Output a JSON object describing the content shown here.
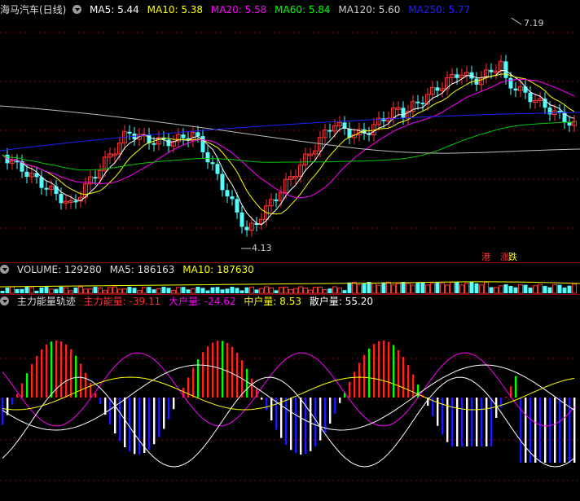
{
  "header": {
    "title": "海马汽车(日线)",
    "ma": [
      {
        "label": "MA5: 5.44",
        "color": "#ffffff"
      },
      {
        "label": "MA10: 5.38",
        "color": "#ffff00"
      },
      {
        "label": "MA20: 5.58",
        "color": "#ff00ff"
      },
      {
        "label": "MA60: 5.84",
        "color": "#00ff00"
      },
      {
        "label": "MA120: 5.60",
        "color": "#cccccc"
      },
      {
        "label": "MA250: 5.77",
        "color": "#0000ff"
      }
    ]
  },
  "price_panel": {
    "high_annotation": "7.19",
    "low_annotation": "4.13",
    "badges": [
      {
        "text": "港",
        "color": "#ff3030"
      },
      {
        "text": "涨",
        "color": "#ff3030"
      },
      {
        "text": "跌",
        "color": "#ffff00"
      }
    ]
  },
  "volume_panel": {
    "items": [
      {
        "label": "VOLUME: 129280",
        "color": "#dddddd"
      },
      {
        "label": "MA5: 186163",
        "color": "#dddddd"
      },
      {
        "label": "MA10: 187630",
        "color": "#ffff00"
      }
    ]
  },
  "indicator_panel": {
    "title": "主力能量轨迹",
    "items": [
      {
        "label": "主力能量: -39.11",
        "color": "#ff3030"
      },
      {
        "label": "大户量: -24.62",
        "color": "#ff00ff"
      },
      {
        "label": "中户量: 8.53",
        "color": "#ffff00"
      },
      {
        "label": "散户量: 55.20",
        "color": "#ffffff"
      }
    ]
  },
  "colors": {
    "up": "#ff3232",
    "down": "#54ffff",
    "grid": "#8a0000",
    "bar_red": "#ff2020",
    "bar_green": "#00ff00",
    "bar_white": "#ffffff",
    "bar_blue": "#1a1aff"
  }
}
